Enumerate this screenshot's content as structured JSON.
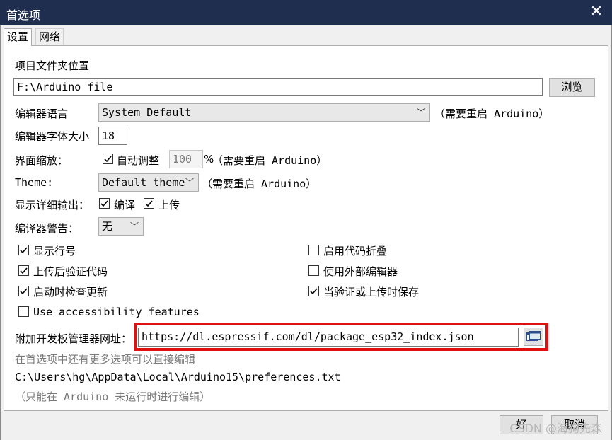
{
  "window": {
    "title": "首选项"
  },
  "tabs": [
    {
      "label": "设置"
    },
    {
      "label": "网络"
    }
  ],
  "settings": {
    "sketchbook_label": "项目文件夹位置",
    "sketchbook_path": "F:\\Arduino file",
    "browse_button": "浏览",
    "language_label": "编辑器语言",
    "language_value": "System Default",
    "language_note": "（需要重启 Arduino）",
    "font_size_label": "编辑器字体大小",
    "font_size_value": "18",
    "scale_label": "界面缩放：",
    "scale_auto_label": "自动调整",
    "scale_value": "100",
    "scale_percent": "%",
    "scale_note": "（需要重启 Arduino）",
    "theme_label": "Theme:",
    "theme_value": "Default theme",
    "theme_note": "（需要重启 Arduino）",
    "verbose_label": "显示详细输出：",
    "verbose_compile": "编译",
    "verbose_upload": "上传",
    "warnings_label": "编译器警告：",
    "warnings_value": "无",
    "checkboxes": {
      "line_numbers": {
        "label": "显示行号",
        "checked": true
      },
      "verify_upload": {
        "label": "上传后验证代码",
        "checked": true
      },
      "check_updates": {
        "label": "启动时检查更新",
        "checked": true
      },
      "accessibility": {
        "label": "Use accessibility features",
        "checked": false
      },
      "code_folding": {
        "label": "启用代码折叠",
        "checked": false
      },
      "external_editor": {
        "label": "使用外部编辑器",
        "checked": false
      },
      "save_on_verify": {
        "label": "当验证或上传时保存",
        "checked": true
      }
    },
    "board_urls_label": "附加开发板管理器网址：",
    "board_urls_value": "https://dl.espressif.com/dl/package_esp32_index.json",
    "more_prefs_note": "在首选项中还有更多选项可以直接编辑",
    "prefs_path": "C:\\Users\\hg\\AppData\\Local\\Arduino15\\preferences.txt",
    "edit_note": "（只能在 Arduino 未运行时进行编辑）"
  },
  "footer": {
    "ok_button": "好",
    "cancel_button": "取消"
  },
  "watermark": "CSDN @海狗先森",
  "colors": {
    "titlebar": "#1f2d4f",
    "highlight_box": "#e01010"
  }
}
